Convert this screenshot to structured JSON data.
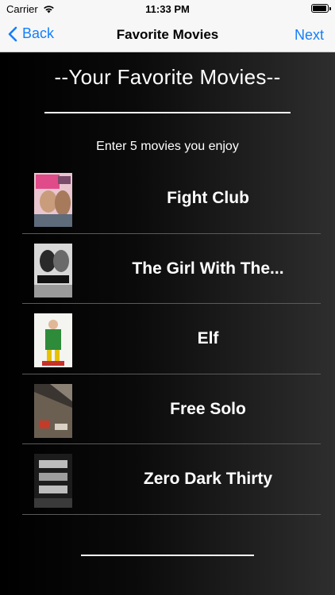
{
  "status_bar": {
    "carrier": "Carrier",
    "time": "11:33 PM"
  },
  "nav": {
    "back_label": "Back",
    "title": "Favorite Movies",
    "next_label": "Next"
  },
  "heading": "--Your Favorite Movies--",
  "subtitle": "Enter 5 movies you enjoy",
  "movies": [
    {
      "title": "Fight Club",
      "poster_icon": "fight-club-poster"
    },
    {
      "title": "The Girl With The...",
      "poster_icon": "girl-with-dragon-tattoo-poster"
    },
    {
      "title": "Elf",
      "poster_icon": "elf-poster"
    },
    {
      "title": "Free Solo",
      "poster_icon": "free-solo-poster"
    },
    {
      "title": "Zero Dark Thirty",
      "poster_icon": "zero-dark-thirty-poster"
    }
  ],
  "colors": {
    "accent": "#147efb",
    "bar_background": "#f7f7f7",
    "text": "#ffffff"
  }
}
